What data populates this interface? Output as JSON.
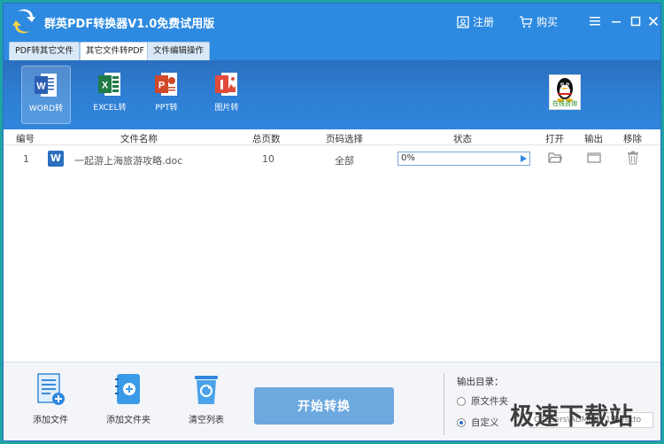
{
  "titlebar": {
    "title": "群英PDF转换器V1.0免费试用版",
    "register_label": "注册",
    "buy_label": "购买"
  },
  "tabs": [
    {
      "label": "PDF转其它文件",
      "active": false
    },
    {
      "label": "其它文件转PDF",
      "active": true
    },
    {
      "label": "文件编辑操作",
      "active": false
    }
  ],
  "toolbar": {
    "tools": [
      {
        "label": "WORD转",
        "icon": "word-icon",
        "active": true,
        "color": "#2b5fb4"
      },
      {
        "label": "EXCEL转",
        "icon": "excel-icon",
        "active": false,
        "color": "#1f7a45"
      },
      {
        "label": "PPT转",
        "icon": "ppt-icon",
        "active": false,
        "color": "#d04a2a"
      },
      {
        "label": "图片转",
        "icon": "image-icon",
        "active": false,
        "color": "#e24a3b"
      }
    ],
    "consult_label": "在线咨询"
  },
  "table": {
    "headers": {
      "index": "编号",
      "filename": "文件名称",
      "pages": "总页数",
      "page_select": "页码选择",
      "status": "状态",
      "open": "打开",
      "output": "输出",
      "remove": "移除"
    },
    "rows": [
      {
        "index": "1",
        "icon": "W",
        "filename": "一起游上海旅游攻略.doc",
        "pages": "10",
        "page_select": "全部",
        "progress": "0%"
      }
    ]
  },
  "bottom": {
    "add_file_label": "添加文件",
    "add_folder_label": "添加文件夹",
    "clear_list_label": "清空列表",
    "start_label": "开始转换",
    "output_title": "输出目录：",
    "option_original": "原文件夹",
    "option_custom": "自定义",
    "custom_path": "C:\\Users\\ADMINI~1\\Deskto",
    "selected_option": "custom"
  },
  "watermark": "极速下载站",
  "colors": {
    "titlebar": "#2d8ae0",
    "toolbar": "#2e7ed4",
    "start_button": "#6da8df",
    "outer_frame": "#1da5a5"
  }
}
